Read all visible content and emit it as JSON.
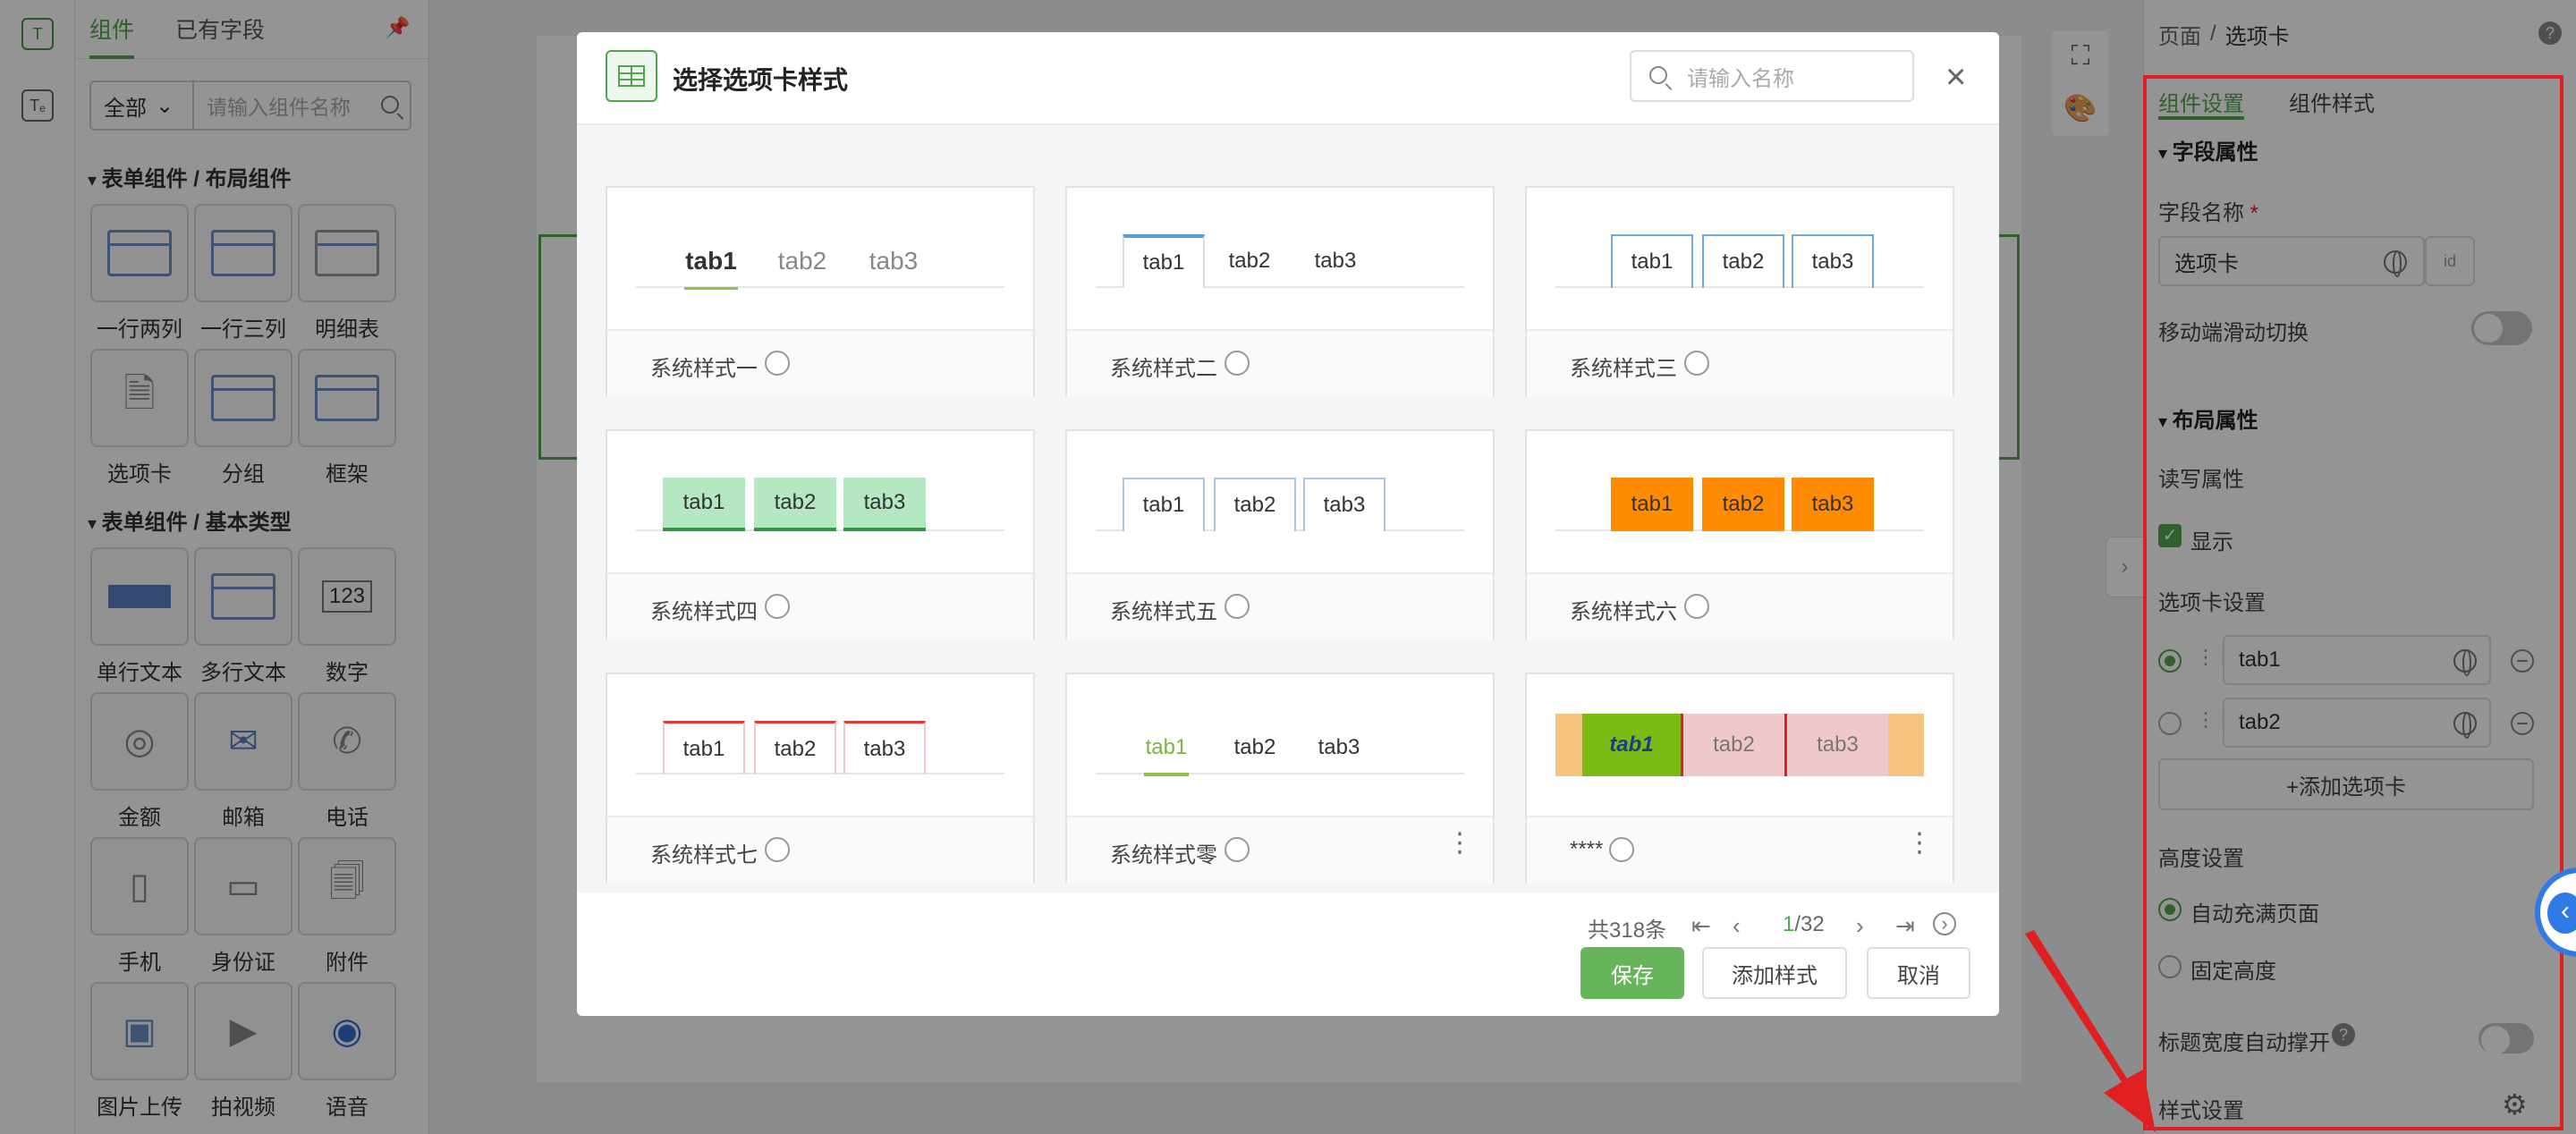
{
  "component_panel": {
    "tab_components": "组件",
    "tab_fields": "已有字段",
    "filter_select": "全部",
    "search_placeholder": "请输入组件名称",
    "section_layout": "表单组件 / 布局组件",
    "layout_items": [
      "一行两列",
      "一行三列",
      "明细表",
      "选项卡",
      "分组",
      "框架"
    ],
    "section_basic": "表单组件 / 基本类型",
    "basic_items": [
      "单行文本",
      "多行文本",
      "数字",
      "金额",
      "邮箱",
      "电话",
      "手机",
      "身份证",
      "附件",
      "图片上传",
      "拍视频",
      "语音"
    ],
    "number_icon_text": "123"
  },
  "props": {
    "breadcrumb_parent": "页面",
    "breadcrumb_sep": "/",
    "breadcrumb_current": "选项卡",
    "tab_settings": "组件设置",
    "tab_style": "组件样式",
    "section_field": "字段属性",
    "field_name_label": "字段名称",
    "required_mark": "*",
    "field_name_value": "选项卡",
    "mobile_swipe_label": "移动端滑动切换",
    "section_layout": "布局属性",
    "rw_label": "读写属性",
    "show_label": "显示",
    "tab_settings_label": "选项卡设置",
    "tabs": [
      "tab1",
      "tab2"
    ],
    "add_tab_label": "+添加选项卡",
    "height_label": "高度设置",
    "height_auto": "自动充满页面",
    "height_fixed": "固定高度",
    "title_width_label": "标题宽度自动撑开",
    "style_settings_label": "样式设置"
  },
  "modal": {
    "title": "选择选项卡样式",
    "search_placeholder": "请输入名称",
    "cards": [
      {
        "name": "系统样式一",
        "tabs": [
          "tab1",
          "tab2",
          "tab3"
        ]
      },
      {
        "name": "系统样式二",
        "tabs": [
          "tab1",
          "tab2",
          "tab3"
        ]
      },
      {
        "name": "系统样式三",
        "tabs": [
          "tab1",
          "tab2",
          "tab3"
        ]
      },
      {
        "name": "系统样式四",
        "tabs": [
          "tab1",
          "tab2",
          "tab3"
        ]
      },
      {
        "name": "系统样式五",
        "tabs": [
          "tab1",
          "tab2",
          "tab3"
        ]
      },
      {
        "name": "系统样式六",
        "tabs": [
          "tab1",
          "tab2",
          "tab3"
        ]
      },
      {
        "name": "系统样式七",
        "tabs": [
          "tab1",
          "tab2",
          "tab3"
        ]
      },
      {
        "name": "系统样式零",
        "tabs": [
          "tab1",
          "tab2",
          "tab3"
        ]
      },
      {
        "name": "****",
        "tabs": [
          "tab1",
          "tab2",
          "tab3"
        ]
      }
    ],
    "total": "共318条",
    "page_current": "1",
    "page_total": "/32",
    "btn_save": "保存",
    "btn_add_style": "添加样式",
    "btn_cancel": "取消"
  },
  "colors": {
    "accent": "#52a54e",
    "highlight_frame": "#e02020",
    "style4_bg": "#b5e8c2",
    "style6_bg": "#ff8c00"
  }
}
